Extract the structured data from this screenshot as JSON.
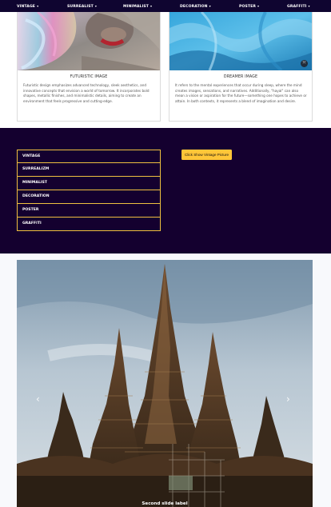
{
  "nav": {
    "items": [
      {
        "label": "VINTAGE",
        "caret": "▾"
      },
      {
        "label": "SURREALIST",
        "caret": "▾"
      },
      {
        "label": "MINIMALIST",
        "caret": "▾"
      },
      {
        "label": "DECORATION",
        "caret": "▾"
      },
      {
        "label": "POSTER",
        "caret": "▾"
      },
      {
        "label": "GRAFFITI",
        "caret": "▾"
      }
    ]
  },
  "cards": [
    {
      "title": "FUTURISTIC IMAGE",
      "text": "Futuristic design emphasizes advanced technology, sleek aesthetics, and innovative concepts that envision a world of tomorrow. It incorporates bold shapes, metallic finishes, and minimalistic details, aiming to create an environment that feels progressive and cutting-edge."
    },
    {
      "title": "DREAMER IMAGE",
      "text": "It refers to the mental experiences that occur during sleep, where the mind creates images, sensations, and narratives. Additionally, \"hayal\" can also mean a vision or aspiration for the future—something one hopes to achieve or attain. In both contexts, it represents a blend of imagination and desire.",
      "badge": "⤧"
    }
  ],
  "menu": {
    "items": [
      "VINTAGE",
      "SURREALIZM",
      "MINIMALIST",
      "DECORATION",
      "POSTER",
      "GRAFFITI"
    ],
    "button_label": "Click Show Vintage Picture"
  },
  "carousel": {
    "prev": "‹",
    "next": "›",
    "caption": "Second slide label"
  },
  "colors": {
    "nav_bg": "#0f0530",
    "dark_bg": "#14002f",
    "accent": "#ffc638"
  }
}
